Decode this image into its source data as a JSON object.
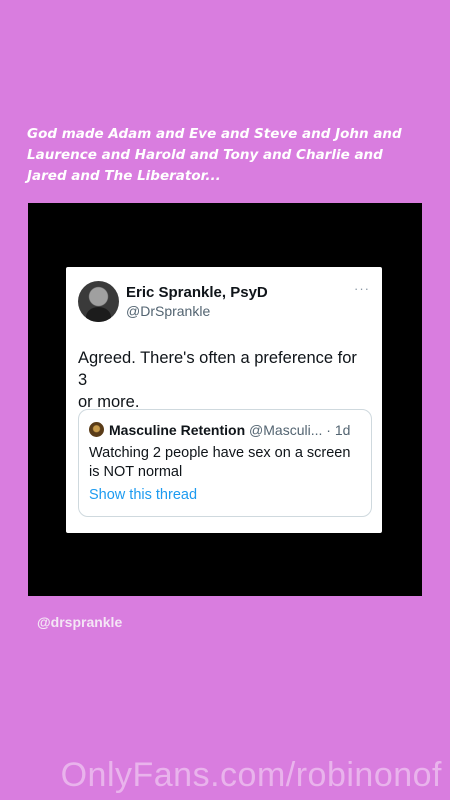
{
  "caption": {
    "line1": "God made Adam and Eve and Steve and John and",
    "line2": "Laurence and Harold and Tony and Charlie and",
    "line3": "Jared and The Liberator..."
  },
  "tweet": {
    "author_name": "Eric Sprankle, PsyD",
    "author_handle": "@DrSprankle",
    "more_icon": "···",
    "body_line1": "Agreed. There's often a preference for 3",
    "body_line2": "or more.",
    "quote": {
      "name": "Masculine Retention",
      "handle": "@Masculi...",
      "time": "· 1d",
      "text_line1": "Watching 2 people have sex on a screen",
      "text_line2": "is NOT normal",
      "show_thread": "Show this thread"
    }
  },
  "mention": "@drsprankle",
  "watermark": "OnlyFans.com/robinonof",
  "colors": {
    "background": "#d97ddf",
    "frame": "#000000",
    "link": "#1d9bf0"
  },
  "icons": {
    "avatar": "profile-photo",
    "more": "more-options-icon",
    "quote_avatar": "profile-photo"
  }
}
